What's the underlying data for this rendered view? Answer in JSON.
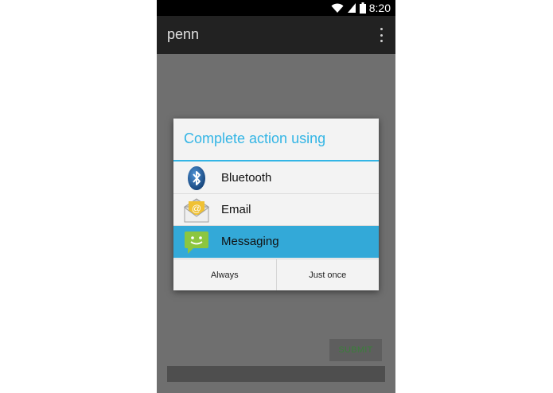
{
  "status_bar": {
    "time": "8:20",
    "icons": [
      "wifi-icon",
      "signal-icon",
      "battery-icon"
    ]
  },
  "action_bar": {
    "title": "penn",
    "overflow_icon": "overflow-menu-icon"
  },
  "content": {
    "submit_label": "SUBMIT"
  },
  "dialog": {
    "title": "Complete action using",
    "options": [
      {
        "label": "Bluetooth",
        "icon": "bluetooth-icon",
        "selected": false
      },
      {
        "label": "Email",
        "icon": "email-icon",
        "selected": false
      },
      {
        "label": "Messaging",
        "icon": "messaging-icon",
        "selected": true
      }
    ],
    "buttons": {
      "always": "Always",
      "just_once": "Just once"
    }
  },
  "colors": {
    "accent": "#33b5e5",
    "selected": "#33a9d8",
    "action_bar": "#222222",
    "dim_background": "#6f6f6f"
  }
}
